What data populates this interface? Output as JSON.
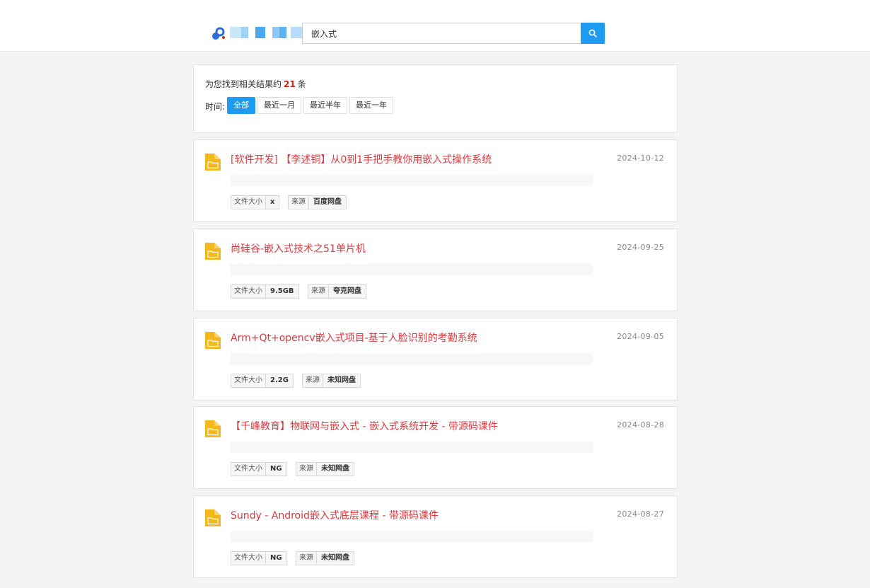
{
  "search": {
    "query": "嵌入式"
  },
  "summary": {
    "found_prefix": "为您找到相关结果约",
    "count": "21",
    "found_suffix": "条",
    "time_label": "时间:",
    "filters": [
      "全部",
      "最近一月",
      "最近半年",
      "最近一年"
    ],
    "active_filter": "全部"
  },
  "tag_labels": {
    "size": "文件大小",
    "source": "来源"
  },
  "results": [
    {
      "title": "[软件开发] 【李述铜】从0到1手把手教你用嵌入式操作系统",
      "date": "2024-10-12",
      "size": "x",
      "source": "百度网盘"
    },
    {
      "title": "尚硅谷-嵌入式技术之51单片机",
      "date": "2024-09-25",
      "size": "9.5GB",
      "source": "夸克网盘"
    },
    {
      "title": "Arm+Qt+opencv嵌入式项目-基于人脸识别的考勤系统",
      "date": "2024-09-05",
      "size": "2.2G",
      "source": "未知网盘"
    },
    {
      "title": "【千峰教育】物联网与嵌入式 - 嵌入式系统开发 - 带源码课件",
      "date": "2024-08-28",
      "size": "NG",
      "source": "未知网盘"
    },
    {
      "title": "Sundy - Android嵌入式底层课程 - 带源码课件",
      "date": "2024-08-27",
      "size": "NG",
      "source": "未知网盘"
    }
  ],
  "colors": {
    "accent": "#1e9bf0",
    "title_red": "#e0383d",
    "count_red": "#d9230e",
    "folder_yellow": "#f5b81c"
  }
}
